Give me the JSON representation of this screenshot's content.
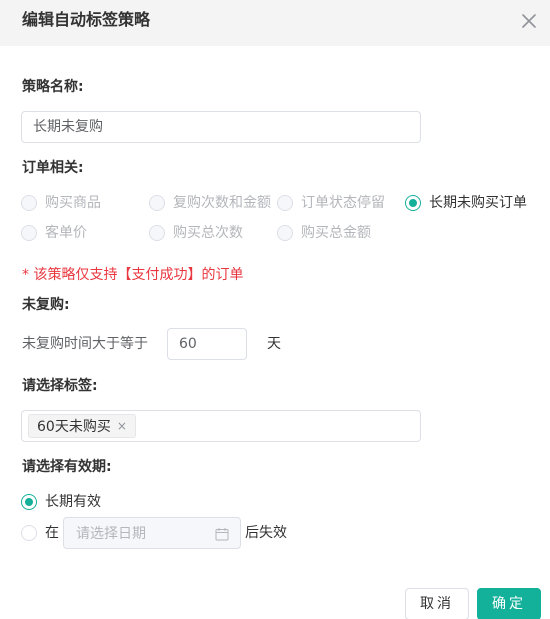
{
  "dialog": {
    "title": "编辑自动标签策略",
    "close_icon": "close-icon"
  },
  "form": {
    "name": {
      "label": "策略名称:",
      "value": "长期未复购"
    },
    "order": {
      "label": "订单相关:",
      "options": [
        {
          "label": "购买商品",
          "state": "disabled"
        },
        {
          "label": "复购次数和金额",
          "state": "disabled"
        },
        {
          "label": "订单状态停留",
          "state": "disabled"
        },
        {
          "label": "长期未购买订单",
          "state": "selected"
        },
        {
          "label": "客单价",
          "state": "disabled"
        },
        {
          "label": "购买总次数",
          "state": "disabled"
        },
        {
          "label": "购买总金额",
          "state": "disabled"
        }
      ],
      "note": "* 该策略仅支持【支付成功】的订单"
    },
    "no_repurchase": {
      "label": "未复购:",
      "prefix": "未复购时间大于等于",
      "value": "60",
      "unit": "天"
    },
    "tags": {
      "label": "请选择标签:",
      "selected": [
        "60天未购买"
      ],
      "remove_icon": "×"
    },
    "validity": {
      "label": "请选择有效期:",
      "option_long": "长期有效",
      "option_at": "在",
      "date_placeholder": "请选择日期",
      "suffix": "后失效",
      "calendar_icon": "calendar-icon"
    }
  },
  "footer": {
    "cancel_label": "取消",
    "ok_label": "确定"
  },
  "colors": {
    "accent": "#13b09a",
    "warning": "#e8373f"
  }
}
